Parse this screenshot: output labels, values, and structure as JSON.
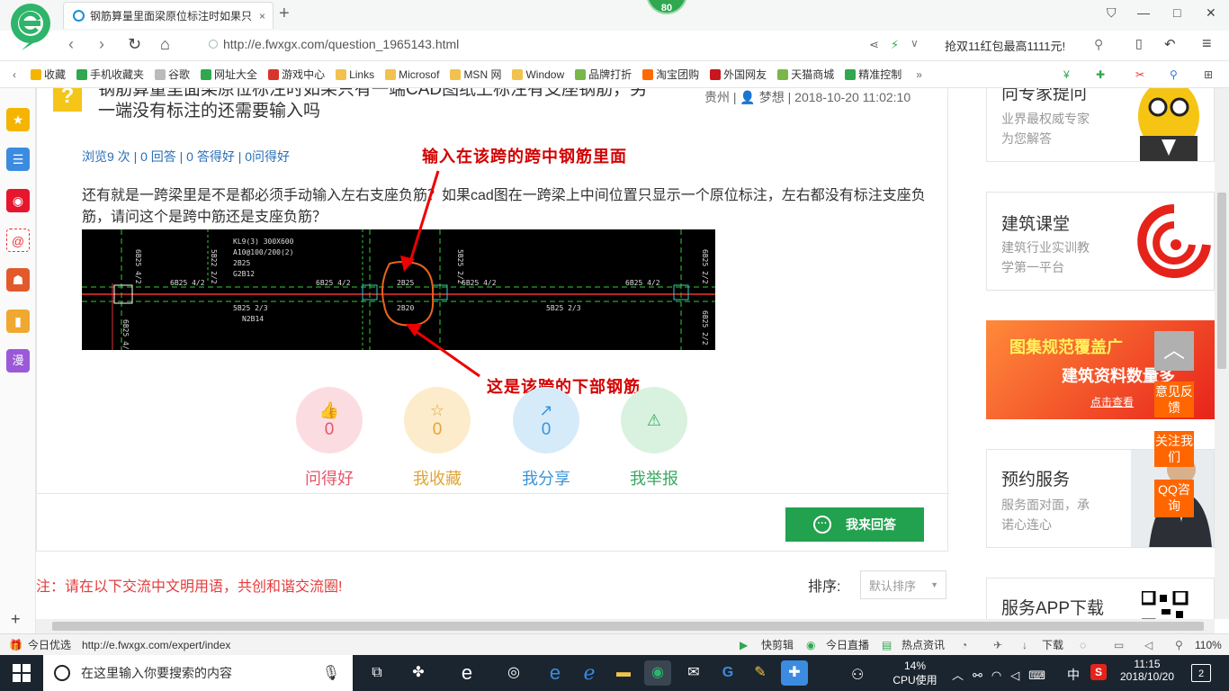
{
  "browser": {
    "tab_title": "钢筋算量里面梁原位标注时如果只",
    "tab_close": "×",
    "new_tab": "+",
    "badge": "80",
    "url": "http://e.fwxgx.com/question_1965143.html",
    "promo": "抢双11红包最高1111元!",
    "win_min": "—",
    "win_max": "□",
    "win_close": "✕",
    "bookmarks": [
      {
        "label": "收藏",
        "color": "#f5b400"
      },
      {
        "label": "手机收藏夹",
        "color": "#2fa84f"
      },
      {
        "label": "谷歌",
        "color": "#bbbbbb"
      },
      {
        "label": "网址大全",
        "color": "#2fa84f"
      },
      {
        "label": "游戏中心",
        "color": "#d9342b"
      },
      {
        "label": "Links",
        "color": "#f2c14e"
      },
      {
        "label": "Microsof",
        "color": "#f2c14e"
      },
      {
        "label": "MSN 网",
        "color": "#f2c14e"
      },
      {
        "label": "Window",
        "color": "#f2c14e"
      },
      {
        "label": "品牌打折",
        "color": "#7ab648"
      },
      {
        "label": "淘宝团购",
        "color": "#ff6a00"
      },
      {
        "label": "外国网友",
        "color": "#c9151e"
      },
      {
        "label": "天猫商城",
        "color": "#7ab648"
      },
      {
        "label": "精准控制",
        "color": "#2fa84f"
      }
    ],
    "bookmarks_more": "»"
  },
  "question": {
    "title": "钢筋算量里面梁原位标注时如果只有一端CAD图纸上标注有支座钢筋，另一端没有标注的还需要输入吗",
    "location": "贵州",
    "user": "梦想",
    "datetime": "2018-10-20 11:02:10",
    "stats": "浏览9 次 | 0 回答 | 0 答得好 | 0问得好",
    "body": "还有就是一跨梁里是不是都必须手动输入左右支座负筋？如果cad图在一跨梁上中间位置只显示一个原位标注，左右都没有标注支座负筋，请问这个是跨中筋还是支座负筋？",
    "annotation_top": "输入在该跨的跨中钢筋里面",
    "annotation_bottom": "这是该跨的下部钢筋",
    "cad_labels": [
      "6B25 4/2",
      "5B22 2/2",
      "KL9(3) 300X600",
      "A10@100/200(2)",
      "2B25",
      "G2B12",
      "6B25 4/2",
      "6B25 4/2",
      "2B25",
      "6B25 4/2",
      "6B25 4/2",
      "6B25 2/2",
      "6B25 4/2",
      "5B25 2/3",
      "N2B14",
      "2B20",
      "5B25 2/3",
      "5B25 2/2",
      "6B25 2/2"
    ]
  },
  "actions": [
    {
      "label": "问得好",
      "count": "0",
      "color": "#e8546b",
      "bg": "#fbdde1",
      "icon": "👍"
    },
    {
      "label": "我收藏",
      "count": "0",
      "color": "#e0a537",
      "bg": "#fdeccc",
      "icon": "☆"
    },
    {
      "label": "我分享",
      "count": "0",
      "color": "#3b94d9",
      "bg": "#d6ebfa",
      "icon": "↗"
    },
    {
      "label": "我举报",
      "count": "",
      "color": "#3aa860",
      "bg": "#d9f2e0",
      "icon": "⚠"
    }
  ],
  "answer_button": "我来回答",
  "notice": "注：请在以下交流中文明用语，共创和谐交流圈!",
  "sort_label": "排序:",
  "sort_value": "默认排序",
  "right_cards": {
    "c1_title": "向专家提问",
    "c1_sub1": "业界最权威专家",
    "c1_sub2": "为您解答",
    "c2_title": "建筑课堂",
    "c2_sub1": "建筑行业实训教",
    "c2_sub2": "学第一平台",
    "c3_title": "图集规范覆盖广",
    "c3_sub": "建筑资料数量多",
    "c3_cta": "点击查看",
    "c4_title": "预约服务",
    "c4_sub1": "服务面对面，承",
    "c4_sub2": "诺心连心",
    "c5_title": "服务APP下载"
  },
  "side_widgets": {
    "feedback": "意见反馈",
    "follow": "关注我们",
    "qq": "QQ咨询"
  },
  "statusbar": {
    "today": "今日优选",
    "hover_url": "http://e.fwxgx.com/expert/index",
    "items": [
      "快剪辑",
      "今日直播",
      "热点资讯",
      "下载"
    ],
    "zoom": "110%"
  },
  "taskbar": {
    "search_placeholder": "在这里输入你要搜索的内容",
    "cpu_pct": "14%",
    "cpu_label": "CPU使用",
    "ime": "中",
    "time": "11:15",
    "date": "2018/10/20",
    "notif": "2"
  }
}
